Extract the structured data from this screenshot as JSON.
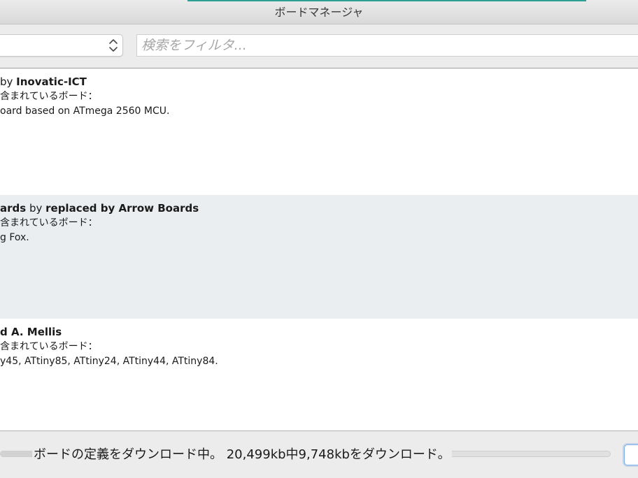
{
  "window": {
    "title": "ボードマネージャ"
  },
  "toolbar": {
    "type_select_value": "",
    "search_placeholder": "検索をフィルタ...",
    "stepper_icon": "up-down-chevron-icon"
  },
  "boards": [
    {
      "name_prefix": "",
      "by": "by ",
      "author": "Inovatic-ICT",
      "included_label": "含まれているボード：",
      "included_boards": "oard based on ATmega 2560 MCU."
    },
    {
      "name_prefix": "ards",
      "by": " by ",
      "author": "replaced by Arrow Boards",
      "included_label": "含まれているボード：",
      "included_boards": "g Fox."
    },
    {
      "name_prefix": "",
      "by": "",
      "author": "d A. Mellis",
      "included_label": "含まれているボード：",
      "included_boards": "y45, ATtiny85, ATtiny24, ATtiny44, ATtiny84."
    }
  ],
  "status": {
    "message": "ボードの定義をダウンロード中。 20,499kb中9,748kbをダウンロード。",
    "downloaded_kb": 9748,
    "total_kb": 20499,
    "cancel_label": ""
  },
  "colors": {
    "accent": "#2f9e93",
    "alt_row": "#ebeef0",
    "focus_ring": "#7faee8"
  }
}
